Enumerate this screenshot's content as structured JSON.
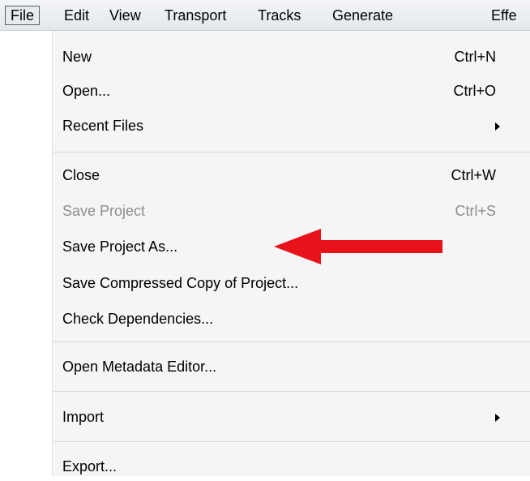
{
  "menubar": {
    "items": [
      {
        "label": "File",
        "active": true
      },
      {
        "label": "Edit"
      },
      {
        "label": "View"
      },
      {
        "label": "Transport"
      },
      {
        "label": "Tracks"
      },
      {
        "label": "Generate"
      },
      {
        "label": "Effe"
      }
    ]
  },
  "file_menu": {
    "items": [
      {
        "label": "New",
        "shortcut": "Ctrl+N",
        "enabled": true
      },
      {
        "label": "Open...",
        "shortcut": "Ctrl+O",
        "enabled": true
      },
      {
        "label": "Recent Files",
        "submenu": true,
        "enabled": true
      },
      {
        "label": "Close",
        "shortcut": "Ctrl+W",
        "enabled": true
      },
      {
        "label": "Save Project",
        "shortcut": "Ctrl+S",
        "enabled": false
      },
      {
        "label": "Save Project As...",
        "enabled": true,
        "highlighted_by_annotation": true
      },
      {
        "label": "Save Compressed Copy of Project...",
        "enabled": true
      },
      {
        "label": "Check Dependencies...",
        "enabled": true
      },
      {
        "label": "Open Metadata Editor...",
        "enabled": true
      },
      {
        "label": "Import",
        "submenu": true,
        "enabled": true
      },
      {
        "label": "Export...",
        "enabled": true
      }
    ]
  },
  "annotation": {
    "icon": "red-pointer-arrow-icon",
    "color": "#e8121a"
  },
  "colors": {
    "menubar_bg": "#e6e9ed",
    "menu_bg": "#f5f5f5",
    "gutter_bg": "#ffffff",
    "disabled_text": "#8d8d8d"
  }
}
